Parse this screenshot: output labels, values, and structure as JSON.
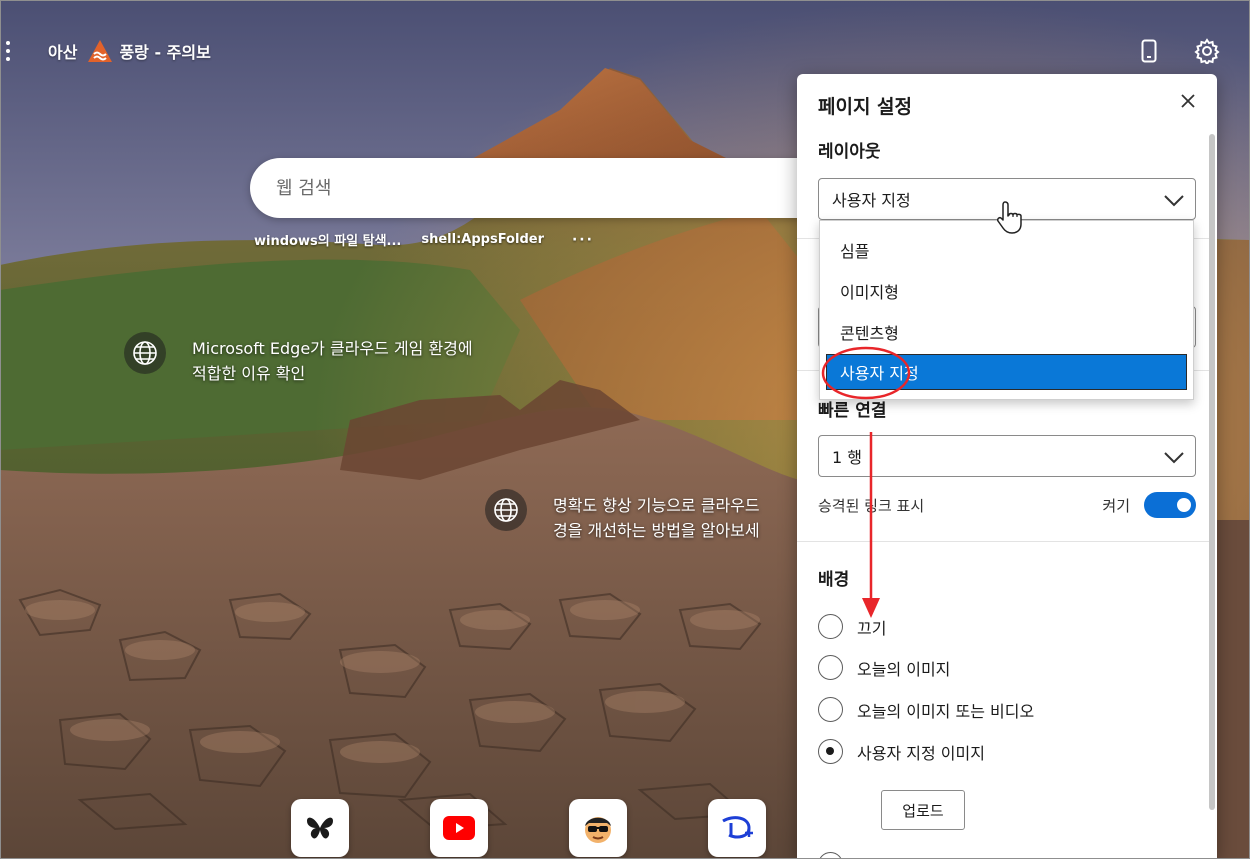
{
  "weather": {
    "city": "아산",
    "alert": "풍랑 - 주의보"
  },
  "search": {
    "placeholder": "웹 검색"
  },
  "quicklinks": [
    {
      "label": "windows의 파일 탐색..."
    },
    {
      "label": "shell:AppsFolder"
    },
    {
      "label": "···"
    }
  ],
  "info_cards": [
    {
      "line1": "Microsoft Edge가 클라우드 게임 환경에",
      "line2": "적합한 이유 확인"
    },
    {
      "line1": "명확도 향상 기능으로 클라우드",
      "line2": "경을 개선하는 방법을 알아보세"
    }
  ],
  "tiles": [
    {
      "icon": "butterfly-icon"
    },
    {
      "icon": "youtube-icon"
    },
    {
      "icon": "avatar-sunglasses-icon"
    },
    {
      "icon": "disney-plus-icon"
    }
  ],
  "panel": {
    "title": "페이지 설정",
    "layout": {
      "title": "레이아웃",
      "value": "사용자 지정",
      "options": [
        "심플",
        "이미지형",
        "콘텐츠형",
        "사용자 지정"
      ],
      "selected_index": 3
    },
    "quick_links": {
      "title": "빠른 연결",
      "value": "1 행",
      "promoted_label": "승격된 링크 표시",
      "toggle_label": "켜기",
      "toggle_on": true
    },
    "background": {
      "title": "배경",
      "options": [
        "끄기",
        "오늘의 이미지",
        "오늘의 이미지 또는 비디오",
        "사용자 지정 이미지"
      ],
      "selected_index": 3,
      "upload_label": "업로드"
    }
  },
  "colors": {
    "accent": "#0a78d7",
    "annotation": "#e8262a"
  }
}
